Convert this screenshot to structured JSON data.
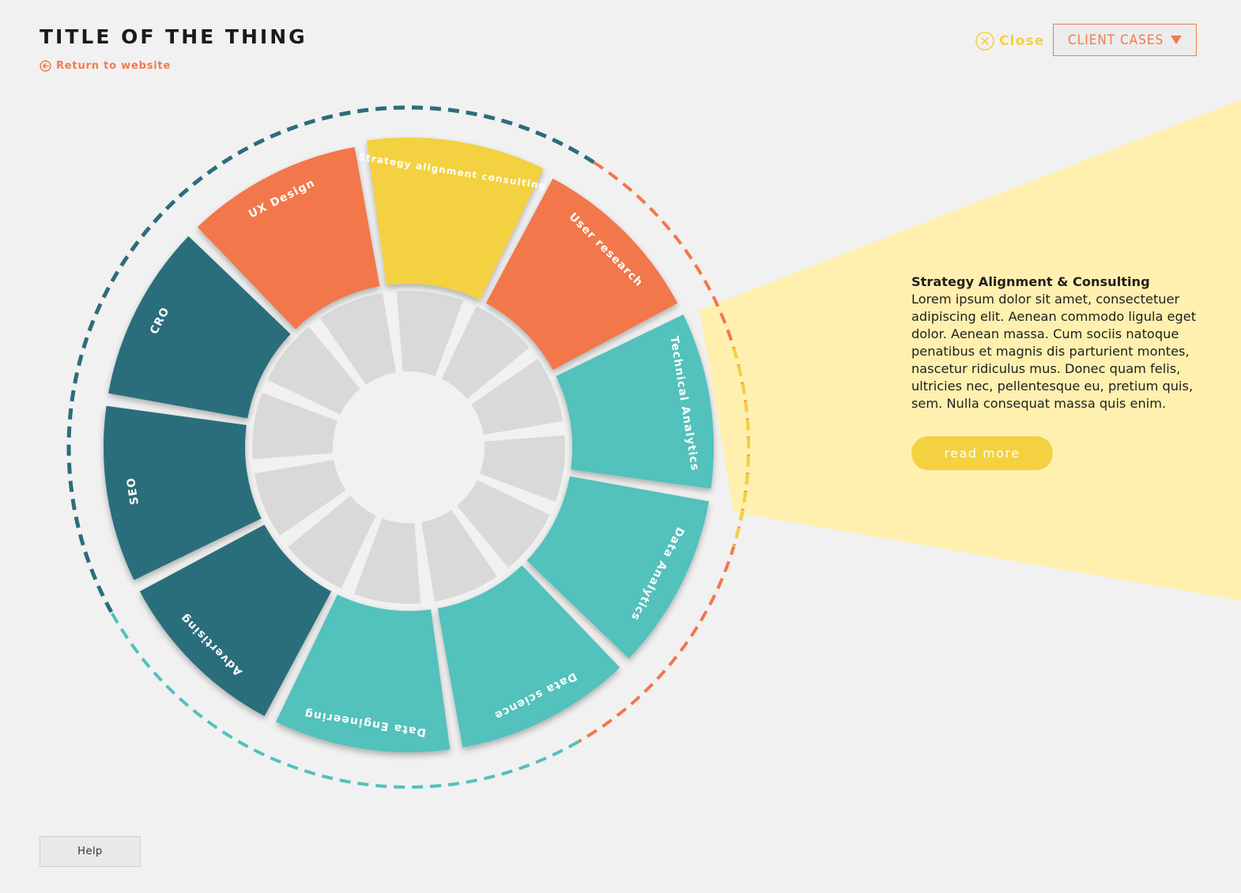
{
  "header": {
    "title": "TITLE OF THE THING",
    "back_label": "Return to website",
    "close_label": "Close",
    "dropdown_label": "CLIENT CASES"
  },
  "colors": {
    "background": "#f1f1f1",
    "dark_teal": "#2a6e7b",
    "teal": "#52c1bc",
    "orange": "#f2774b",
    "yellow": "#f3d140",
    "beam": "#fff0b0",
    "inner_ring": "#d9d9d9"
  },
  "wheel": {
    "segments": [
      {
        "label": "CRO",
        "color": "dark_teal"
      },
      {
        "label": "UX Design",
        "color": "orange"
      },
      {
        "label": "Strategy alignment consulting",
        "color": "yellow",
        "selected": true
      },
      {
        "label": "User research",
        "color": "orange"
      },
      {
        "label": "Technical Analytics",
        "color": "teal"
      },
      {
        "label": "Data Analytics",
        "color": "teal"
      },
      {
        "label": "Data science",
        "color": "teal"
      },
      {
        "label": "Data Engineering",
        "color": "teal"
      },
      {
        "label": "Advertising",
        "color": "dark_teal"
      },
      {
        "label": "SEO",
        "color": "dark_teal"
      }
    ]
  },
  "info": {
    "heading": "Strategy Alignment & Consulting",
    "body": "Lorem ipsum dolor sit amet, consectetuer adipiscing elit. Aenean commodo ligula eget dolor. Aenean massa. Cum sociis natoque penatibus et magnis dis parturient montes, nascetur ridiculus mus. Donec quam felis, ultricies nec, pellentesque eu, pretium quis, sem. Nulla consequat massa quis enim.",
    "button_label": "read more"
  },
  "footer": {
    "help_label": "Help"
  }
}
